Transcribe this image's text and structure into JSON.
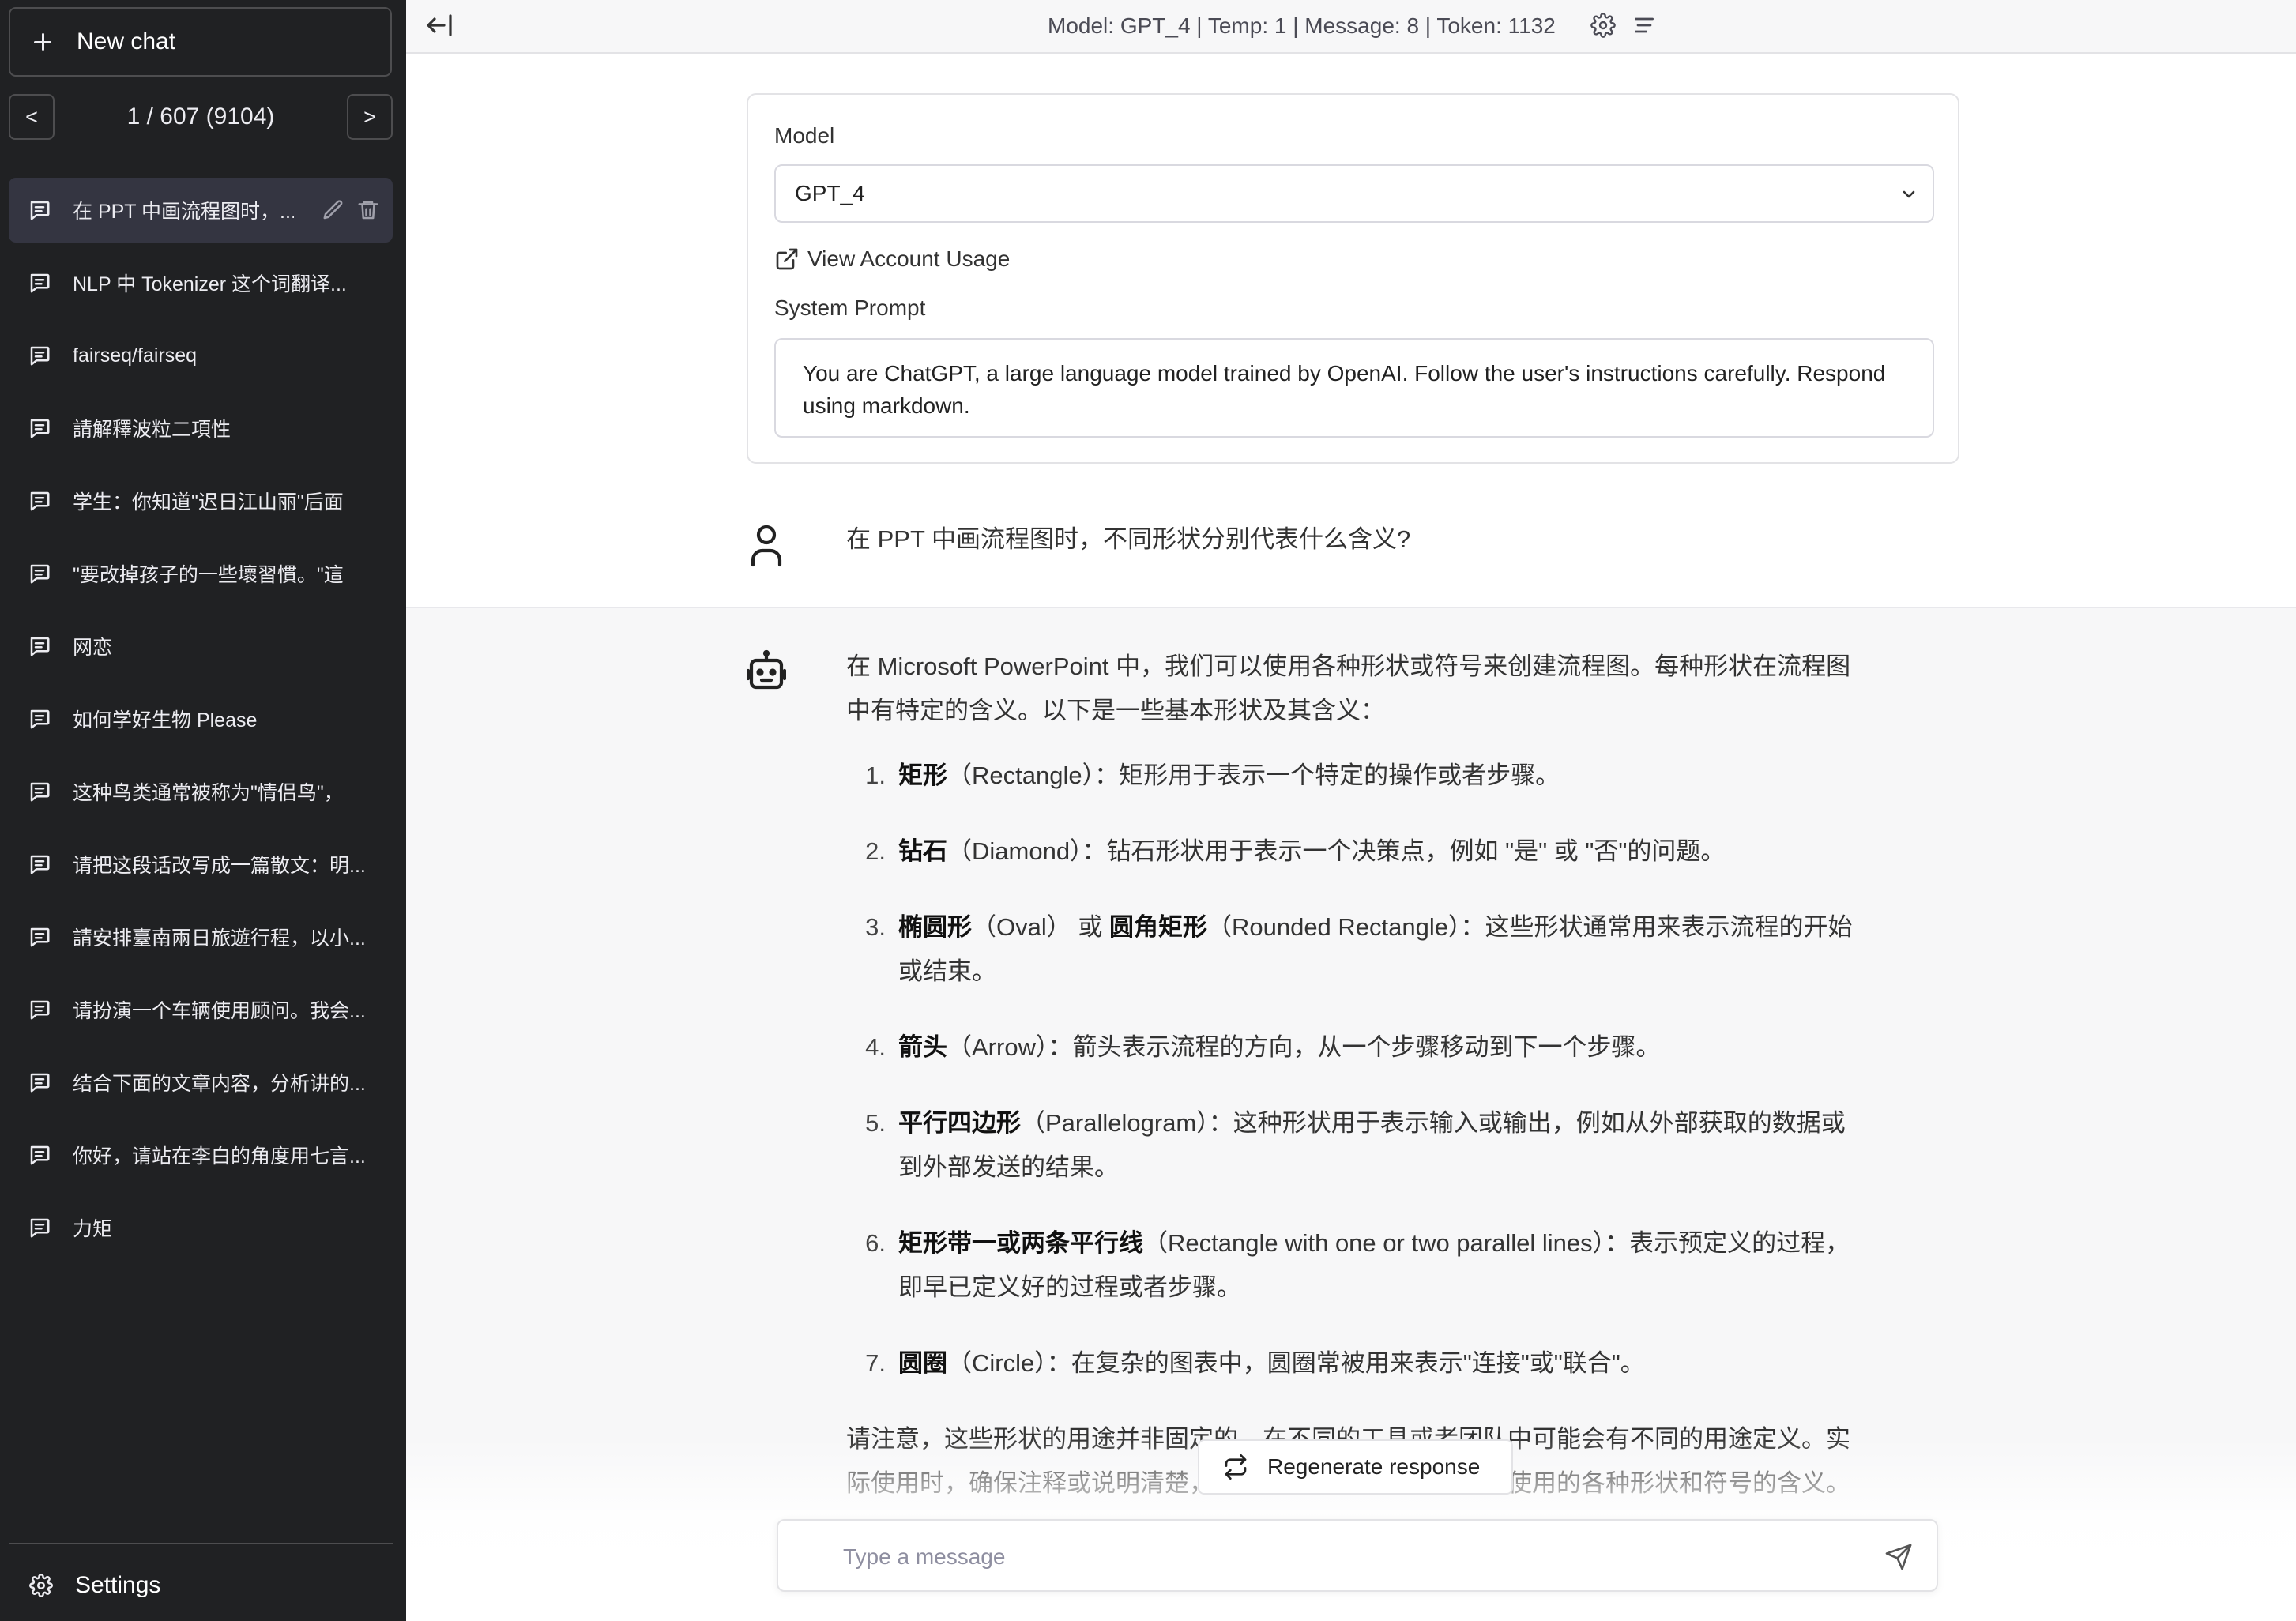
{
  "sidebar": {
    "new_chat_label": "New chat",
    "pager": {
      "prev_label": "<",
      "next_label": ">",
      "text": "1 / 607 (9104)"
    },
    "chats": [
      {
        "title": "在 PPT 中画流程图时，...",
        "active": true
      },
      {
        "title": "NLP 中 Tokenizer 这个词翻译..."
      },
      {
        "title": "fairseq/fairseq"
      },
      {
        "title": "請解釋波粒二項性"
      },
      {
        "title": "学生：你知道\"迟日江山丽\"后面"
      },
      {
        "title": "\"要改掉孩子的一些壞習慣。\"這"
      },
      {
        "title": "网恋"
      },
      {
        "title": "如何学好生物 Please"
      },
      {
        "title": "这种鸟类通常被称为\"情侣鸟\"，"
      },
      {
        "title": "请把这段话改写成一篇散文：明..."
      },
      {
        "title": "請安排臺南兩日旅遊行程，以小..."
      },
      {
        "title": "请扮演一个车辆使用顾问。我会..."
      },
      {
        "title": "结合下面的文章内容，分析讲的..."
      },
      {
        "title": "你好，请站在李白的角度用七言..."
      },
      {
        "title": "力矩"
      }
    ],
    "settings_label": "Settings"
  },
  "header": {
    "info": "Model: GPT_4 | Temp: 1 | Message: 8 | Token: 1132"
  },
  "settings_card": {
    "model_label": "Model",
    "model_value": "GPT_4",
    "usage_link": "View Account Usage",
    "system_prompt_label": "System Prompt",
    "system_prompt": "You are ChatGPT, a large language model trained by OpenAI. Follow the user's instructions carefully. Respond using markdown."
  },
  "conversation": {
    "user_message": "在 PPT 中画流程图时，不同形状分别代表什么含义?",
    "assistant": {
      "intro": "在 Microsoft PowerPoint 中，我们可以使用各种形状或符号来创建流程图。每种形状在流程图中有特定的含义。以下是一些基本形状及其含义：",
      "items": [
        {
          "num": "1.",
          "term": "矩形",
          "rest": "（Rectangle）：矩形用于表示一个特定的操作或者步骤。"
        },
        {
          "num": "2.",
          "term": "钻石",
          "rest": "（Diamond）：钻石形状用于表示一个决策点，例如 \"是\" 或 \"否\"的问题。"
        },
        {
          "num": "3.",
          "term": "椭圆形",
          "mid": "（Oval） 或 ",
          "term2": "圆角矩形",
          "rest": "（Rounded Rectangle）：这些形状通常用来表示流程的开始或结束。"
        },
        {
          "num": "4.",
          "term": "箭头",
          "rest": "（Arrow）：箭头表示流程的方向，从一个步骤移动到下一个步骤。"
        },
        {
          "num": "5.",
          "term": "平行四边形",
          "rest": "（Parallelogram）：这种形状用于表示输入或输出，例如从外部获取的数据或到外部发送的结果。"
        },
        {
          "num": "6.",
          "term": "矩形带一或两条平行线",
          "rest": "（Rectangle with one or two parallel lines）：表示预定义的过程，即早已定义好的过程或者步骤。"
        },
        {
          "num": "7.",
          "term": "圆圈",
          "rest": "（Circle）：在复杂的图表中，圆圈常被用来表示\"连接\"或\"联合\"。"
        }
      ],
      "outro": "请注意，这些形状的用途并非固定的，在不同的工具或者团队中可能会有不同的用途定义。实际使用时，确保注释或说明清楚，所有参与者都理解流程图中使用的各种形状和符号的含义。"
    }
  },
  "regenerate_label": "Regenerate response",
  "composer": {
    "placeholder": "Type a message",
    "value": ""
  },
  "icons": {
    "new_chat": "plus-icon",
    "chat": "message-icon",
    "edit": "pencil-icon",
    "delete": "trash-icon",
    "settings": "gear-icon",
    "collapse": "collapse-sidebar-icon",
    "menu": "list-icon",
    "external": "external-link-icon",
    "chevron": "chevron-down-icon",
    "user": "user-icon",
    "bot": "robot-icon",
    "regenerate": "refresh-icon",
    "send": "send-icon"
  },
  "colors": {
    "sidebar_bg": "#202123",
    "sidebar_active": "#343541",
    "assistant_bg": "#f7f7f8"
  }
}
